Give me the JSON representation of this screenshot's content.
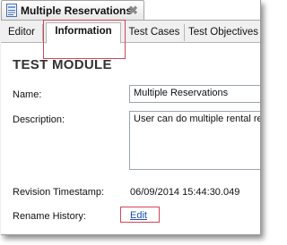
{
  "window": {
    "title": "Multiple Reservations",
    "close_glyph": "✖"
  },
  "tabs": [
    {
      "label": "Editor"
    },
    {
      "label": "Information"
    },
    {
      "label": "Test Cases"
    },
    {
      "label": "Test Objectives"
    }
  ],
  "module": {
    "heading": "TEST MODULE",
    "name_label": "Name:",
    "name_value": "Multiple Reservations",
    "description_label": "Description:",
    "description_value": "User can do multiple rental reservations",
    "revision_label": "Revision Timestamp:",
    "revision_value": "06/09/2014 15:44:30.049",
    "rename_label": "Rename History:",
    "rename_link": "Edit"
  },
  "icons": {
    "document": "document-icon",
    "close": "close-icon"
  },
  "colors": {
    "highlight": "#d0465a",
    "link": "#1a4fb0"
  }
}
